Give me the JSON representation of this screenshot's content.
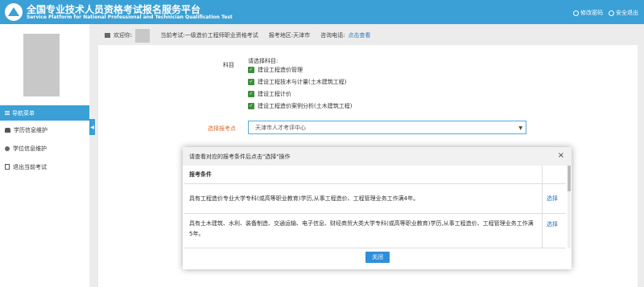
{
  "header": {
    "title_cn": "全国专业技术人员资格考试报名服务平台",
    "title_en": "Service Platform for National Professional and Technician Qualification Test",
    "change_password": "修改密码",
    "logout": "安全退出"
  },
  "sidebar": {
    "nav_title": "导航菜单",
    "items": [
      {
        "label": "学历信息维护",
        "icon": "graduation-cap-icon"
      },
      {
        "label": "学位信息维护",
        "icon": "school-icon"
      },
      {
        "label": "退出当前考试",
        "icon": "exit-icon"
      }
    ]
  },
  "info": {
    "welcome": "欢迎你:",
    "current_exam": "当前考试:一级造价工程师职业资格考试",
    "region": "报考地区:天津市",
    "hotline_label": "咨询电话:",
    "hotline_link": "点击查看"
  },
  "form": {
    "subject_label": "科目",
    "subject_prompt": "请选择科目:",
    "subjects": [
      {
        "label": "建设工程造价管理",
        "checked": true
      },
      {
        "label": "建设工程技术与计量(土木建筑工程)",
        "checked": true
      },
      {
        "label": "建设工程计价",
        "checked": true
      },
      {
        "label": "建设工程造价案例分析(土木建筑工程)",
        "checked": true
      }
    ],
    "site_label": "选择报考点",
    "site_value": "天津市人才考评中心"
  },
  "modal": {
    "title": "请查看对应的报考条件后点击\"选择\"操作",
    "col_header": "报考条件",
    "rows": [
      {
        "condition": "具有工程造价专业大学专科(或高等职业教育)学历,从事工程造价、工程管理业务工作满4年。",
        "action": "选择"
      },
      {
        "condition": "具有土木建筑、水利、装备制造、交通运输、电子信息、财经商贸大类大学专科(或高等职业教育)学历,从事工程造价、工程管理业务工作满5年。",
        "action": "选择"
      }
    ],
    "close_label": "关闭"
  },
  "colors": {
    "primary": "#3aa0d6",
    "accent": "#e06b2a",
    "link": "#2a78c2",
    "checkbox": "#3b8f3b"
  }
}
